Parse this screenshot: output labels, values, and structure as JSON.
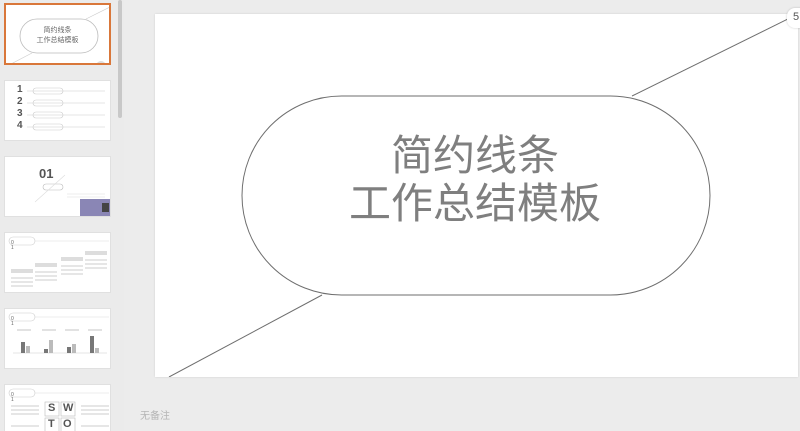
{
  "slide": {
    "title_line1": "简约线条",
    "title_line2": "工作总结模板"
  },
  "thumbnails": {
    "t1": {
      "line1": "简约线条",
      "line2": "工作总结模板"
    },
    "t2": {
      "numbers": [
        "1",
        "2",
        "3",
        "4"
      ]
    },
    "t3": {
      "number": "01"
    },
    "t6": {
      "letters": [
        "S",
        "W",
        "T",
        "O"
      ]
    }
  },
  "notes": {
    "placeholder": "无备注"
  },
  "corner_button": {
    "label": "5"
  }
}
